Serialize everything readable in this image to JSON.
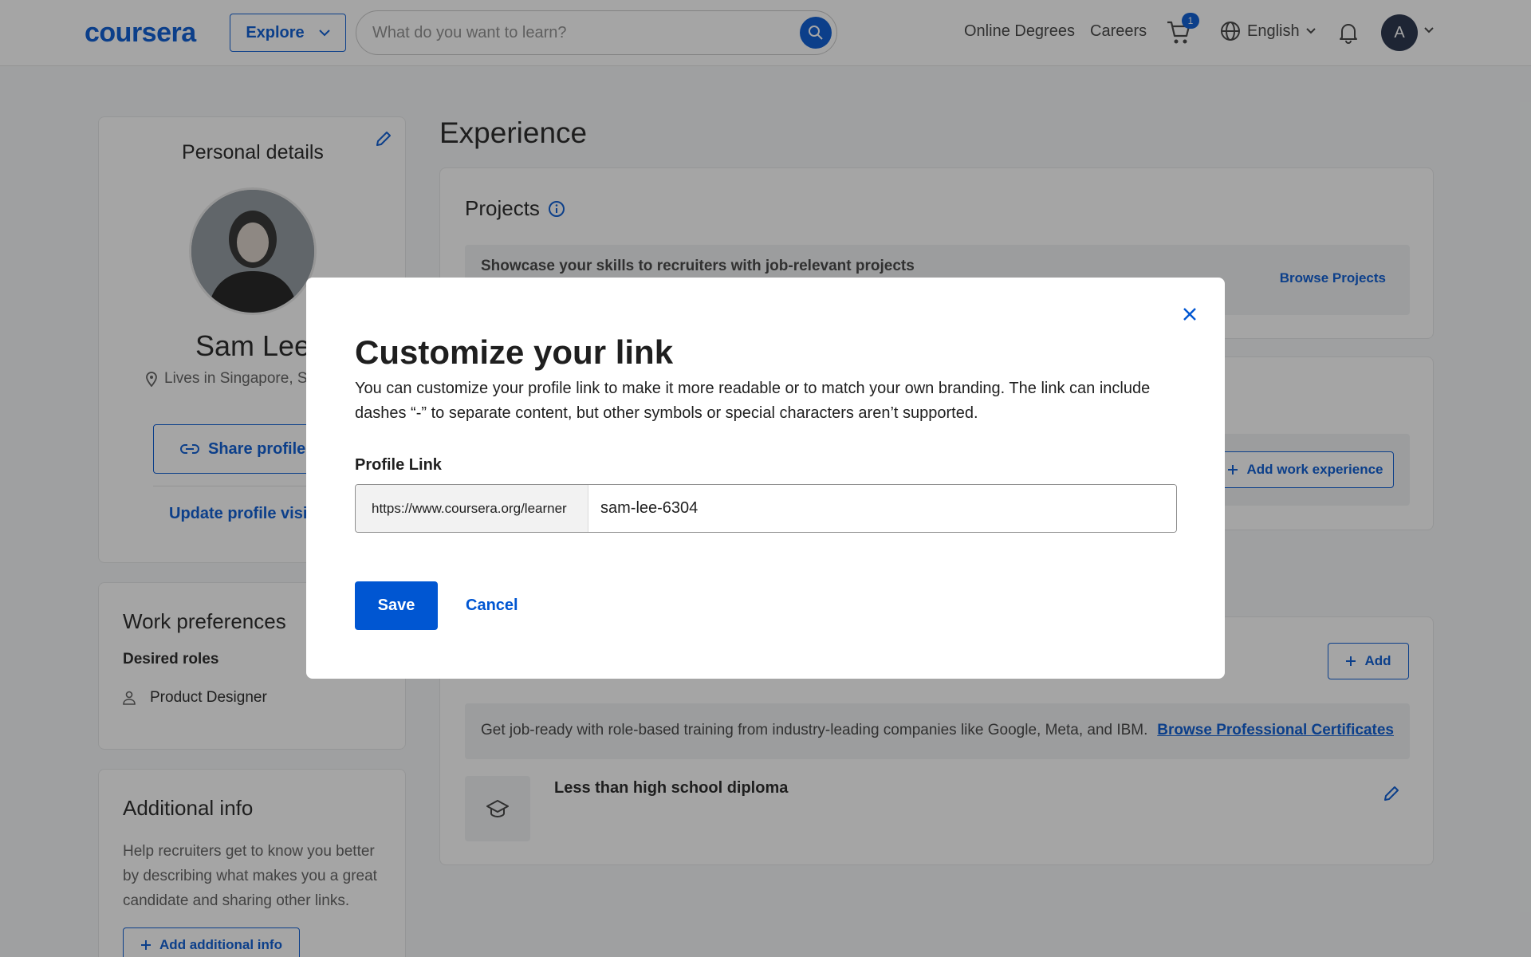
{
  "header": {
    "logo": "coursera",
    "explore_label": "Explore",
    "search_placeholder": "What do you want to learn?",
    "online_degrees": "Online Degrees",
    "careers": "Careers",
    "cart_count": "1",
    "language": "English",
    "avatar_initial": "A"
  },
  "personal": {
    "title": "Personal details",
    "name": "Sam Lee",
    "location": "Lives in Singapore, Si",
    "share_label": "Share profile l",
    "update_label": "Update profile visib"
  },
  "work_prefs": {
    "title": "Work preferences",
    "desired_roles_label": "Desired roles",
    "role": "Product Designer"
  },
  "additional_info": {
    "title": "Additional info",
    "description": "Help recruiters get to know you better by describing what makes you a great candidate and sharing other links.",
    "add_label": "Add additional info"
  },
  "experience": {
    "heading": "Experience",
    "projects_title": "Projects",
    "projects_prompt": "Showcase your skills to recruiters with job-relevant projects",
    "browse_projects": "Browse Projects",
    "add_work_experience": "Add work experience"
  },
  "education": {
    "add_label": "Add",
    "promo_text": "Get job-ready with role-based training from industry-leading companies like Google, Meta, and IBM.",
    "promo_link": "Browse Professional Certificates",
    "entry_title": "Less than high school diploma"
  },
  "modal": {
    "title": "Customize your link",
    "description": "You can customize your profile link to make it more readable or to match your own branding. The link can include dashes “-” to separate content, but other symbols or special characters aren’t supported.",
    "field_label": "Profile Link",
    "prefix": "https://www.coursera.org/learner",
    "value": "sam-lee-6304",
    "save_label": "Save",
    "cancel_label": "Cancel"
  },
  "colors": {
    "brand": "#0056d2",
    "overlay": "rgba(31,31,31,0.4)"
  }
}
